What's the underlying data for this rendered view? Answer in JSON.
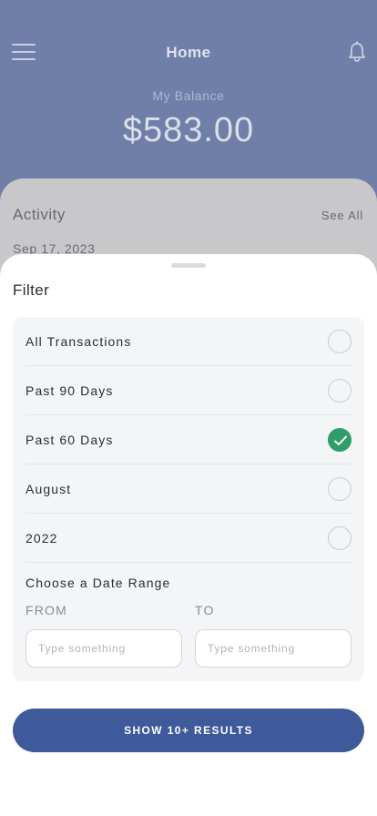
{
  "header": {
    "title": "Home",
    "menu_icon": "hamburger-menu-icon",
    "bell_icon": "bell-icon"
  },
  "balance": {
    "label": "My Balance",
    "amount": "$583.00"
  },
  "activity": {
    "title": "Activity",
    "see_all": "See All",
    "first_date": "Sep 17, 2023"
  },
  "filter": {
    "title": "Filter",
    "options": [
      {
        "label": "All Transactions",
        "selected": false
      },
      {
        "label": "Past 90 Days",
        "selected": false
      },
      {
        "label": "Past 60 Days",
        "selected": true
      },
      {
        "label": "August",
        "selected": false
      },
      {
        "label": "2022",
        "selected": false
      }
    ],
    "date_range": {
      "title": "Choose a Date Range",
      "from_label": "FROM",
      "to_label": "TO",
      "from_placeholder": "Type something",
      "to_placeholder": "Type something",
      "from_value": "",
      "to_value": ""
    },
    "submit_label": "SHOW 10+ RESULTS"
  },
  "colors": {
    "header_bg": "#6f7fa8",
    "accent_button": "#3e5a9a",
    "check_green": "#2f9e6a"
  }
}
